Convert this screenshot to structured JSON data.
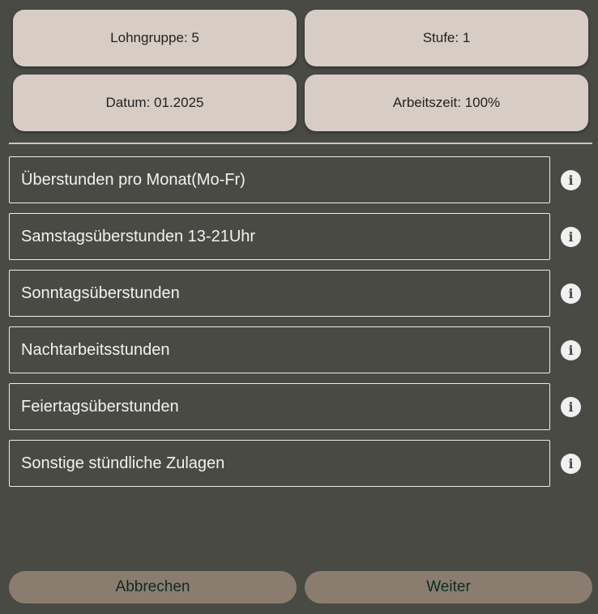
{
  "summary": {
    "cards": [
      {
        "label": "Lohngruppe: 5"
      },
      {
        "label": "Stufe: 1"
      },
      {
        "label": "Datum: 01.2025"
      },
      {
        "label": "Arbeitszeit: 100%"
      }
    ]
  },
  "fields": [
    {
      "placeholder": "Überstunden pro Monat(Mo-Fr)"
    },
    {
      "placeholder": "Samstagsüberstunden 13-21Uhr"
    },
    {
      "placeholder": "Sonntagsüberstunden"
    },
    {
      "placeholder": "Nachtarbeitsstunden"
    },
    {
      "placeholder": "Feiertagsüberstunden"
    },
    {
      "placeholder": "Sonstige stündliche Zulagen"
    }
  ],
  "info_icon_glyph": "i",
  "actions": {
    "cancel_label": "Abbrechen",
    "next_label": "Weiter"
  },
  "colors": {
    "background": "#4a4a45",
    "card": "#d7cdc5",
    "button": "#8a7d70",
    "button_text": "#0e2a23"
  }
}
